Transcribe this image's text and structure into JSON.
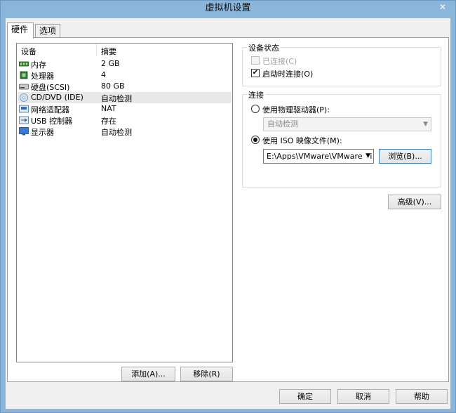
{
  "window": {
    "title": "虚拟机设置",
    "close_label": "✕"
  },
  "tabs": [
    {
      "label": "硬件",
      "active": true
    },
    {
      "label": "选项",
      "active": false
    }
  ],
  "device_list": {
    "headers": {
      "device": "设备",
      "summary": "摘要"
    },
    "rows": [
      {
        "name": "内存",
        "summary": "2 GB",
        "icon": "memory-icon",
        "selected": false
      },
      {
        "name": "处理器",
        "summary": "4",
        "icon": "processor-icon",
        "selected": false
      },
      {
        "name": "硬盘(SCSI)",
        "summary": "80 GB",
        "icon": "hard-disk-icon",
        "selected": false
      },
      {
        "name": "CD/DVD (IDE)",
        "summary": "自动检测",
        "icon": "cd-dvd-icon",
        "selected": true
      },
      {
        "name": "网络适配器",
        "summary": "NAT",
        "icon": "network-adapter-icon",
        "selected": false
      },
      {
        "name": "USB 控制器",
        "summary": "存在",
        "icon": "usb-icon",
        "selected": false
      },
      {
        "name": "显示器",
        "summary": "自动检测",
        "icon": "display-icon",
        "selected": false
      }
    ],
    "add_label": "添加(A)...",
    "remove_label": "移除(R)"
  },
  "device_status": {
    "title": "设备状态",
    "connected_label": "已连接(C)",
    "connected_checked": false,
    "connect_on_power_label": "启动时连接(O)",
    "connect_on_power_checked": true
  },
  "connection": {
    "title": "连接",
    "physical_label": "使用物理驱动器(P):",
    "physical_selected": false,
    "physical_value": "自动检测",
    "iso_label": "使用 ISO 映像文件(M):",
    "iso_selected": true,
    "iso_path": "E:\\Apps\\VMware\\VMware Vi",
    "browse_label": "浏览(B)..."
  },
  "advanced_label": "高级(V)...",
  "footer": {
    "ok_label": "确定",
    "cancel_label": "取消",
    "help_label": "帮助"
  }
}
